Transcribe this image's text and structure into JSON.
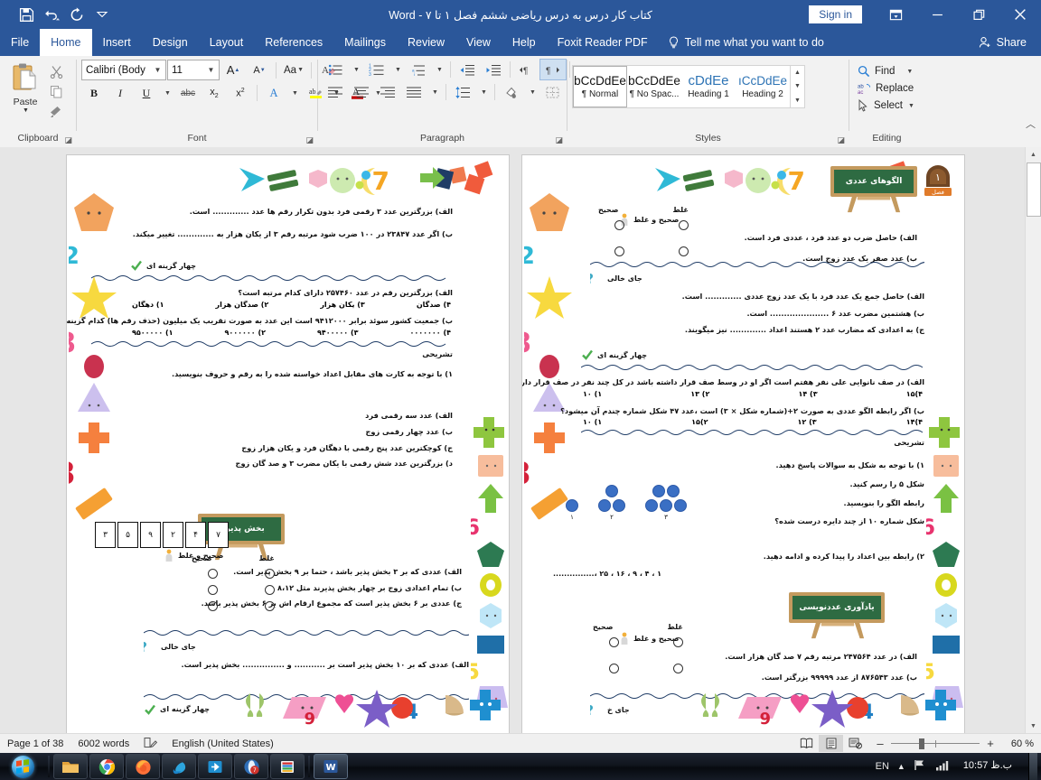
{
  "titlebar": {
    "title": "کتاب کار درس به درس ریاضی ششم  فصل ۱ تا ۷  -  Word",
    "signin": "Sign in",
    "qat": {
      "save": "save-icon",
      "undo": "undo-icon",
      "redo": "redo-icon",
      "customize": "customize-qat-icon"
    },
    "window": {
      "ribbon_display": "ribbon-display-options",
      "minimize": "–",
      "restore": "restore",
      "close": "×"
    }
  },
  "tabs": [
    {
      "label": "File",
      "active": false
    },
    {
      "label": "Home",
      "active": true
    },
    {
      "label": "Insert",
      "active": false
    },
    {
      "label": "Design",
      "active": false
    },
    {
      "label": "Layout",
      "active": false
    },
    {
      "label": "References",
      "active": false
    },
    {
      "label": "Mailings",
      "active": false
    },
    {
      "label": "Review",
      "active": false
    },
    {
      "label": "View",
      "active": false
    },
    {
      "label": "Help",
      "active": false
    },
    {
      "label": "Foxit Reader PDF",
      "active": false
    }
  ],
  "tellme": "Tell me what you want to do",
  "share": "Share",
  "ribbon": {
    "clipboard": {
      "label": "Clipboard",
      "paste": "Paste",
      "cut": "cut-icon",
      "copy": "copy-icon",
      "format_painter": "format-painter-icon"
    },
    "font": {
      "label": "Font",
      "font_name": "Calibri (Body",
      "font_size": "11",
      "grow": "A",
      "shrink": "A",
      "change_case": "Aa",
      "clear_formatting": "clear-formatting-icon",
      "bold": "B",
      "italic": "I",
      "underline": "U",
      "strikethrough": "abc",
      "subscript": "x₂",
      "superscript": "x²",
      "text_effects": "A",
      "highlight": "ab",
      "font_color": "A"
    },
    "paragraph": {
      "label": "Paragraph",
      "bullets": "bullets-icon",
      "numbering": "numbering-icon",
      "multilevel": "multilevel-list-icon",
      "decrease_indent": "decrease-indent-icon",
      "increase_indent": "increase-indent-icon",
      "ltr": "left-to-right-icon",
      "rtl": "right-to-left-icon",
      "sort": "sort-icon",
      "show_marks": "¶",
      "align_left": "align-left-icon",
      "align_center": "align-center-icon",
      "align_right": "align-right-icon",
      "justify": "justify-icon",
      "line_spacing": "line-spacing-icon",
      "shading": "shading-icon",
      "borders": "borders-icon"
    },
    "styles": {
      "label": "Styles",
      "items": [
        {
          "preview": "bCcDdEe",
          "name": "¶ Normal",
          "selected": true
        },
        {
          "preview": "bCcDdEe",
          "name": "¶ No Spac...",
          "selected": false
        },
        {
          "preview": "cDdEe",
          "name": "Heading 1",
          "selected": false
        },
        {
          "preview": "ıCcDdEe",
          "name": "Heading 2",
          "selected": false
        }
      ]
    },
    "editing": {
      "label": "Editing",
      "find": "Find",
      "replace": "Replace",
      "select": "Select"
    }
  },
  "document": {
    "left_page": {
      "fill_blank_items": [
        "الف) بزرگترین عدد ۳ رقمی فرد بدون تکرار رقم ها عدد ............. است.",
        "ب) اگر عدد ۲۳۸۴۷ در ۱۰۰ ضرب شود مرتبه رقم ۳ از یکان هزار به ............. تغییر میکند."
      ],
      "mcq_heading": "چهار گزینه ای",
      "mcq": [
        {
          "q": "الف) بزرگترین رقم در عدد ۲۵۷۴۶۰ دارای کدام مرتبه است؟",
          "options": [
            "۱) دهگان",
            "۲) صدگان هزار",
            "۳) یکان هزار",
            "۴) صدگان"
          ]
        },
        {
          "q": "ب) جمعیت کشور سوئد برابر ۹۴۱۲۰۰۰ است این عدد به صورت تقریب یک میلیون (حذف رقم ها) کدام گزینه است؟",
          "options": [
            "۱) ۹۵۰۰۰۰۰",
            "۲) ۹۰۰۰۰۰۰",
            "۳) ۹۴۰۰۰۰۰",
            "۴) ۰۰۰۰۰۰۰"
          ]
        }
      ],
      "essay_heading": "تشریحی",
      "essay_intro": "۱) با توجه به کارت های مقابل اعداد خواسته شده را به رقم و حروف بنویسید.",
      "essay_items": [
        "الف) عدد سه رقمی فرد",
        "ب) عدد چهار رقمی زوج",
        "ج) کوچکترین عدد پنج رقمی با دهگان فرد و یکان هزار زوج",
        "د) بزرگترین عدد شش رقمی با یکان مضرب ۳ و صد گان زوج"
      ],
      "cards": [
        "۳",
        "۵",
        "۹",
        "۲",
        "۴",
        "۷"
      ],
      "board_title": "بخش پذیری",
      "tf_heading": "صحیح و غلط",
      "tf_col_correct": "صحیح",
      "tf_col_wrong": "غلط",
      "tf_items": [
        "الف) عددی که بر ۳ بخش پذیر باشد ، حتما بر ۹ بخش پذیر است.",
        "ب) تمام اعدادی زوج بر چهار بخش پذیرند مثل ۸،۱۲",
        "ج) عددی بر ۶ بخش پذیر است که مجموع ارقام اش بر ۶ بخش پذیر باشد."
      ],
      "blank_heading": "جای خالی",
      "blank_items": [
        "الف) عددی که بر ۱۰ بخش پذیر است بر ........... و ............... بخش پذیر است."
      ],
      "bottom_heading": "چهار گزینه ای"
    },
    "right_page": {
      "chapter_badge": "۱",
      "chapter_label": "فصل",
      "board_title": "الگوهای عددی",
      "tf_heading": "صحیح و غلط",
      "tf_col_correct": "صحیح",
      "tf_col_wrong": "غلط",
      "tf_items": [
        "الف) حاصل ضرب دو عدد فرد ، عددی فرد است.",
        "ب) عدد صفر یک عدد زوج است."
      ],
      "blank_heading": "جای خالی",
      "blank_items": [
        "الف) حاصل جمع یک عدد فرد با یک عدد زوج عددی ............. است.",
        "ب) هشتمین مضرب عدد ۶ ..................... است.",
        "ج) به اعدادی که مضارب عدد ۲ هستند اعداد ............. نیز میگویند."
      ],
      "mcq_heading": "چهار گزینه ای",
      "mcq": [
        {
          "q": "الف) در صف نانوایی علی نفر هفتم است اگر او در وسط صف قرار داشته باشد در کل چند نفر در صف قرار دارند؟",
          "options": [
            "۱)  ۱۰",
            "۲) ۱۳",
            "۳) ۱۴",
            "۴)۱۵"
          ]
        },
        {
          "q": "ب) اگر رابطه الگو عددی به صورت    ۲+(شماره شکل × ۳) است ،عدد ۴۷ شکل شماره چندم آن میشود؟",
          "options": [
            "۱)  ۱۰",
            "۲)۱۵",
            "۳) ۱۲",
            "۴)۱۴"
          ]
        }
      ],
      "essay_heading": "تشریحی",
      "essay_items": [
        "۱) با توجه به شکل به سوالات پاسخ دهید.",
        "شکل ۵ را رسم کنید.",
        "رابطه الگو را بنویسید.",
        "شکل شماره ۱۰ از چند دایره درست شده؟",
        "۲) رابطه بین اعداد را پیدا کرده و ادامه دهید."
      ],
      "sequence": "۱ ، ۴ ، ۹ ، ۱۶ ، ۲۵ ،...............",
      "figure_labels": [
        "۱",
        "۲",
        "۳"
      ],
      "board_title2": "یادآوری عددنویسی",
      "tf2_heading": "صحیح و غلط",
      "tf2_items": [
        "الف) در عدد ۲۴۷۵۶۴ مرتبه رقم ۷ صد گان هزار است.",
        "ب) عدد ۸۷۶۵۴۳ از عدد ۹۹۹۹۹ بزرگتر است."
      ],
      "bottom_heading": "جای خ"
    }
  },
  "statusbar": {
    "page": "Page 1 of 38",
    "words": "6002 words",
    "proofing": "proofing-icon",
    "language": "English (United States)",
    "views": [
      {
        "name": "read-mode",
        "active": false
      },
      {
        "name": "print-layout",
        "active": true
      },
      {
        "name": "web-layout",
        "active": false
      }
    ],
    "zoom_out": "–",
    "zoom_in": "+",
    "zoom_level": "60 %"
  },
  "taskbar": {
    "start": "start-orb",
    "items": [
      {
        "name": "file-explorer",
        "running": false
      },
      {
        "name": "google-chrome",
        "running": false
      },
      {
        "name": "firefox",
        "running": false
      },
      {
        "name": "internet-explorer",
        "running": false
      },
      {
        "name": "eject-device",
        "running": false
      },
      {
        "name": "opera",
        "running": false
      },
      {
        "name": "winrar",
        "running": false
      },
      {
        "name": "microsoft-word",
        "running": true
      }
    ],
    "tray": {
      "language": "EN",
      "show_hidden": "show-hidden-icons",
      "flag": "flag-icon",
      "network": "network-icon"
    },
    "clock_time": "10:57",
    "clock_meridiem": "ب.ظ"
  }
}
